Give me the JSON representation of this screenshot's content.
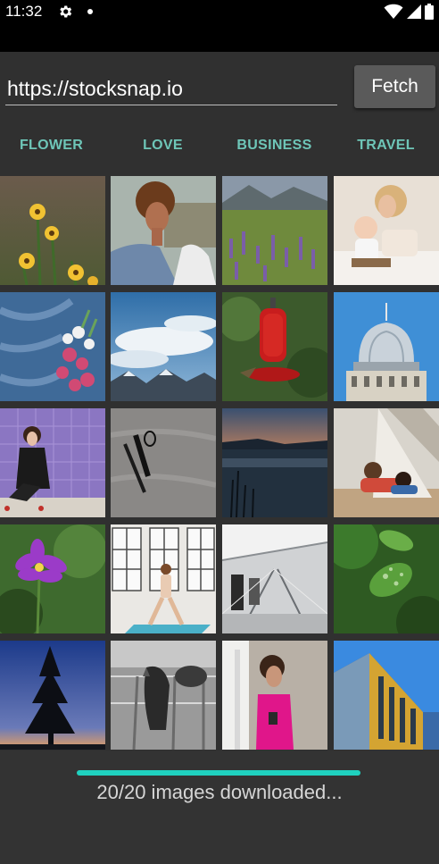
{
  "status_bar": {
    "time": "11:32",
    "icons": [
      "gear-icon",
      "notification-dot-icon",
      "wifi-icon",
      "signal-icon",
      "battery-icon"
    ]
  },
  "url_bar": {
    "value": "https://stocksnap.io",
    "fetch_label": "Fetch"
  },
  "tabs": [
    {
      "label": "FLOWER"
    },
    {
      "label": "LOVE"
    },
    {
      "label": "BUSINESS"
    },
    {
      "label": "TRAVEL"
    }
  ],
  "colors": {
    "background": "#303030",
    "accent": "#6ec6b8",
    "progress": "#1fd1bf",
    "fetch_button": "#5a5a5a"
  },
  "images": [
    {
      "subject": "yellow wildflowers"
    },
    {
      "subject": "woman with curly hair in denim jacket"
    },
    {
      "subject": "purple lupine meadow with mountains"
    },
    {
      "subject": "mother reading with baby on bed"
    },
    {
      "subject": "pink flowers on denim fabric"
    },
    {
      "subject": "mountains under cloudy blue sky"
    },
    {
      "subject": "hummingbird at red feeder"
    },
    {
      "subject": "domed building under blue sky"
    },
    {
      "subject": "woman sitting against purple tile wall"
    },
    {
      "subject": "pen and pencil on grey surface"
    },
    {
      "subject": "lake at sunset"
    },
    {
      "subject": "father and child under teepee tent"
    },
    {
      "subject": "purple flower on green background"
    },
    {
      "subject": "woman doing yoga with child by windows"
    },
    {
      "subject": "train station platform"
    },
    {
      "subject": "raindrops on green leaves"
    },
    {
      "subject": "pine tree silhouette at dusk"
    },
    {
      "subject": "horses behind fence in black and white"
    },
    {
      "subject": "woman in pink top looking at phone"
    },
    {
      "subject": "modern building facade"
    }
  ],
  "progress": {
    "fraction": 1.0,
    "text": "20/20 images downloaded..."
  }
}
